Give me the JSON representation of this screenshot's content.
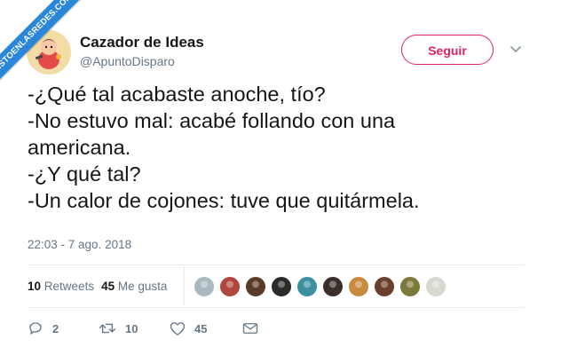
{
  "watermark": {
    "text": "VISTOENLASREDES.COM"
  },
  "author": {
    "name": "Cazador de Ideas",
    "handle": "@ApuntoDisparo"
  },
  "follow_button": {
    "label": "Seguir",
    "color": "#e0245e"
  },
  "tweet": {
    "lines": [
      "-¿Qué tal acabaste anoche, tío?",
      "-No estuvo mal: acabé follando con una",
      "americana.",
      "-¿Y qué tal?",
      "-Un calor de cojones: tuve que quitármela."
    ],
    "timestamp": "22:03 - 7 ago. 2018"
  },
  "stats": {
    "retweets_count": "10",
    "retweets_label": "Retweets",
    "likes_count": "45",
    "likes_label": "Me gusta"
  },
  "likers": [
    {
      "icon": "user-avatar",
      "color": "#aab8c2"
    },
    {
      "icon": "user-avatar",
      "color": "#b0473f"
    },
    {
      "icon": "user-avatar",
      "color": "#5a3b2a"
    },
    {
      "icon": "user-avatar",
      "color": "#2b2b2b"
    },
    {
      "icon": "user-avatar",
      "color": "#3c8fa0"
    },
    {
      "icon": "user-avatar",
      "color": "#3a2f2a"
    },
    {
      "icon": "user-avatar",
      "color": "#c98a3e"
    },
    {
      "icon": "user-avatar",
      "color": "#6b3f2b"
    },
    {
      "icon": "user-avatar",
      "color": "#7c7a3a"
    },
    {
      "icon": "user-avatar",
      "color": "#d8d8d0"
    }
  ],
  "actions": {
    "reply_count": "2",
    "retweet_count": "10",
    "like_count": "45"
  }
}
